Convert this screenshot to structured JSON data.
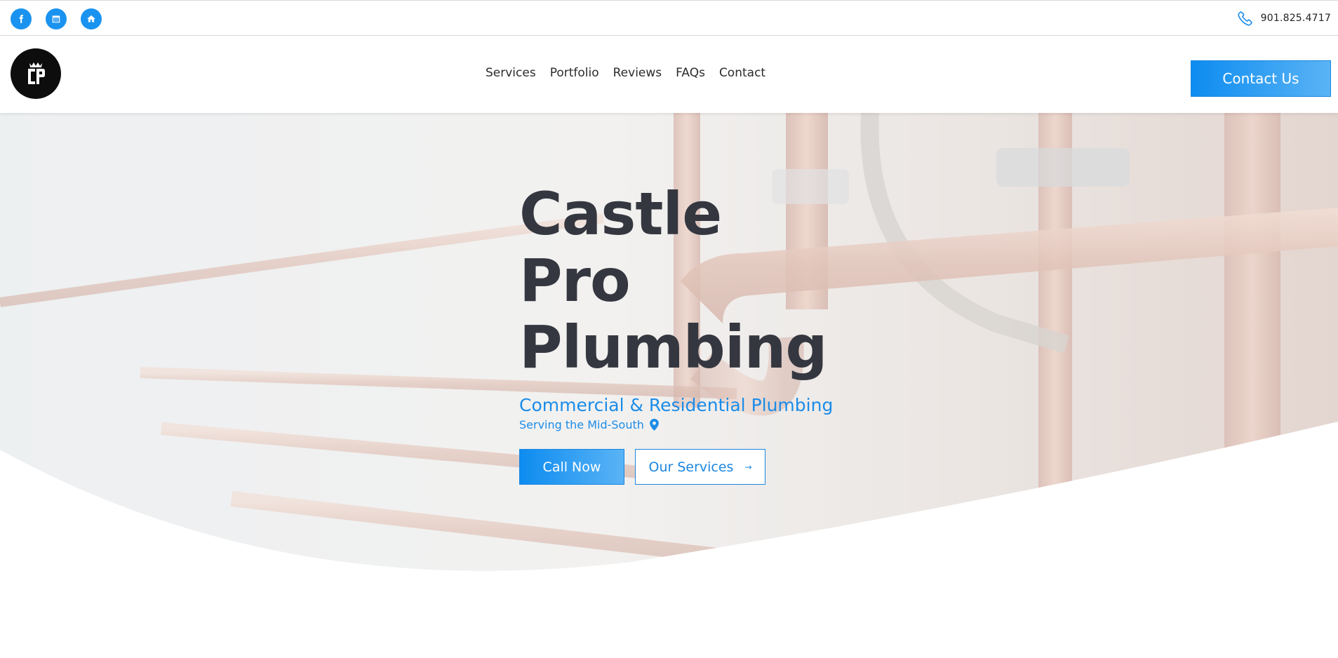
{
  "topbar": {
    "social": [
      {
        "icon": "facebook-icon"
      },
      {
        "icon": "calendar-icon"
      },
      {
        "icon": "home-icon"
      }
    ],
    "phone": "901.825.4717",
    "phone_icon": "phone-icon"
  },
  "header": {
    "logo_icon": "castle-pro-logo",
    "nav": [
      "Services",
      "Portfolio",
      "Reviews",
      "FAQs",
      "Contact"
    ],
    "contact_button": "Contact Us"
  },
  "hero": {
    "title_lines": [
      "Castle",
      "Pro",
      "Plumbing"
    ],
    "tagline": "Commercial & Residential Plumbing",
    "serving": "Serving the Mid-South",
    "serving_icon": "location-pin-icon",
    "call_button": "Call Now",
    "services_button": "Our Services",
    "services_button_icon": "arrow-right-icon"
  },
  "colors": {
    "accent": "#1b8ce8",
    "title": "#353740",
    "logo_bg": "#0d0d0d"
  }
}
